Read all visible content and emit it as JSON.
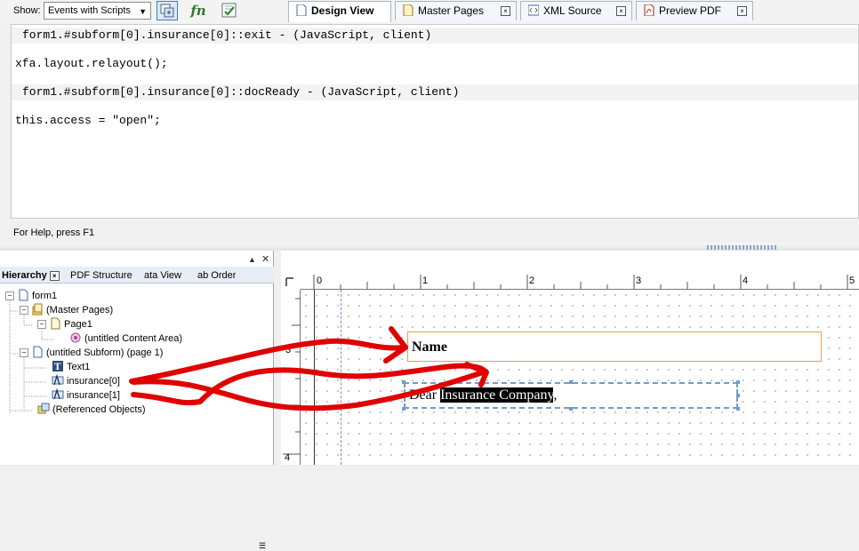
{
  "toolbar": {
    "show_label": "Show:",
    "show_value": "Events with Scripts",
    "events_icon": "events-with-scripts-icon",
    "functions_icon": "function-icon",
    "functions_glyph": "fn",
    "check_icon": "check-script-syntax-icon"
  },
  "script": {
    "blocks": [
      {
        "header": "form1.#subform[0].insurance[0]::exit - (JavaScript, client)",
        "code": "xfa.layout.relayout();"
      },
      {
        "header": "form1.#subform[0].insurance[0]::docReady - (JavaScript, client)",
        "code": "this.access = \"open\";"
      }
    ]
  },
  "status": {
    "help_text": "For Help, press F1"
  },
  "left_panel": {
    "tabs": [
      "Hierarchy",
      "PDF Structure",
      "Data View",
      "Tab Order"
    ],
    "tabs_visible": [
      "Hierarchy",
      "PDF Structure",
      "ata View",
      "ab Order"
    ],
    "tree": [
      {
        "label": "form1",
        "indent": 0,
        "expander": "-",
        "icon": "form-document-icon"
      },
      {
        "label": "(Master Pages)",
        "indent": 1,
        "expander": "-",
        "icon": "master-pages-icon"
      },
      {
        "label": "Page1",
        "indent": 2,
        "expander": "-",
        "icon": "page-icon"
      },
      {
        "label": "(untitled Content Area)",
        "indent": 3,
        "expander": "",
        "icon": "content-area-icon"
      },
      {
        "label": "(untitled Subform) (page 1)",
        "indent": 1,
        "expander": "-",
        "icon": "subform-icon"
      },
      {
        "label": "Text1",
        "indent": 2,
        "expander": "",
        "icon": "text-object-icon"
      },
      {
        "label": "insurance[0]",
        "indent": 2,
        "expander": "",
        "icon": "text-field-icon"
      },
      {
        "label": "insurance[1]",
        "indent": 2,
        "expander": "",
        "icon": "text-field-icon"
      },
      {
        "label": "(Referenced Objects)",
        "indent": 1,
        "expander": "",
        "icon": "referenced-objects-icon"
      }
    ]
  },
  "doc_tabs": [
    {
      "label": "Design View",
      "active": true
    },
    {
      "label": "Master Pages",
      "active": false
    },
    {
      "label": "XML Source",
      "active": false
    },
    {
      "label": "Preview PDF",
      "active": false
    }
  ],
  "rulers": {
    "top": [
      "0",
      "1",
      "2",
      "3",
      "4",
      "5"
    ],
    "left": [
      "3",
      "4"
    ]
  },
  "canvas": {
    "name_field": "Name",
    "dear_prefix": "Dear ",
    "dear_highlight": "Insurance Company",
    "dear_suffix": ","
  },
  "colors": {
    "annotation": "#e00000",
    "field_border": "#e2a24d",
    "selection": "#6f9dc8"
  }
}
